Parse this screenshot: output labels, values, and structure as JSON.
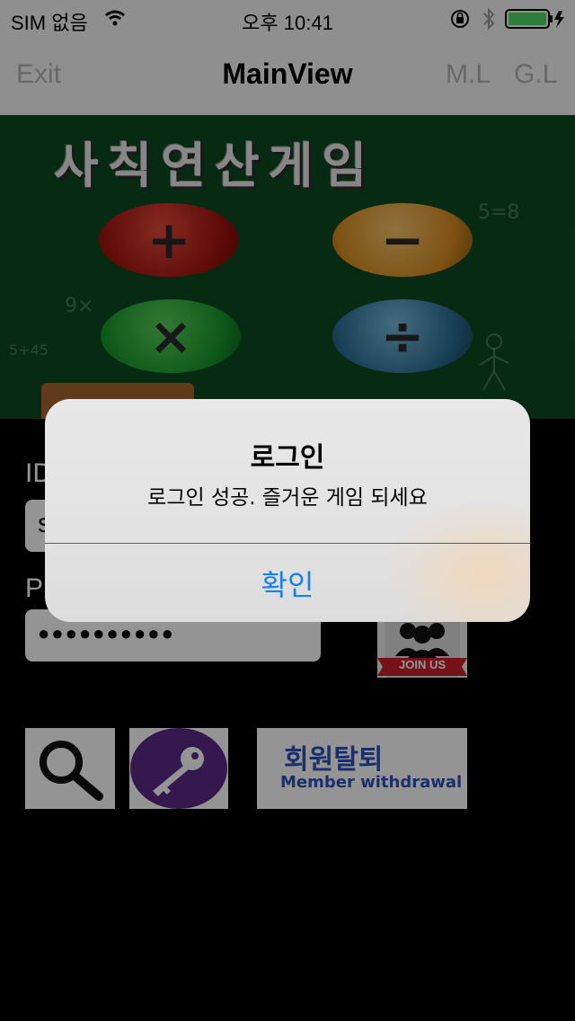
{
  "status": {
    "carrier": "SIM 없음",
    "time": "오후 10:41"
  },
  "nav": {
    "exit": "Exit",
    "title": "MainView",
    "ml": "M.L",
    "gl": "G.L"
  },
  "banner": {
    "title": "사칙연산게임",
    "operators": {
      "plus": "+",
      "minus": "−",
      "times": "×",
      "divide": "÷"
    },
    "chalk": {
      "top_right": "5=8",
      "left": "9×",
      "bottom_left": "5+45"
    }
  },
  "form": {
    "id_label": "ID",
    "id_value": "s",
    "pw_label": "P",
    "pw_value": "●●●●●●●●●●"
  },
  "join": {
    "label": "JOIN US"
  },
  "withdraw": {
    "korean": "회원탈퇴",
    "english": "Member withdrawal"
  },
  "alert": {
    "title": "로그인",
    "message": "로그인 성공. 즐거운 게임 되세요",
    "ok": "확인"
  },
  "colors": {
    "accent": "#1a7cf7",
    "banner_green": "#0d4a20",
    "withdraw_blue": "#2d52b8",
    "key_purple": "#5b2a87",
    "battery_green": "#4cd964"
  }
}
